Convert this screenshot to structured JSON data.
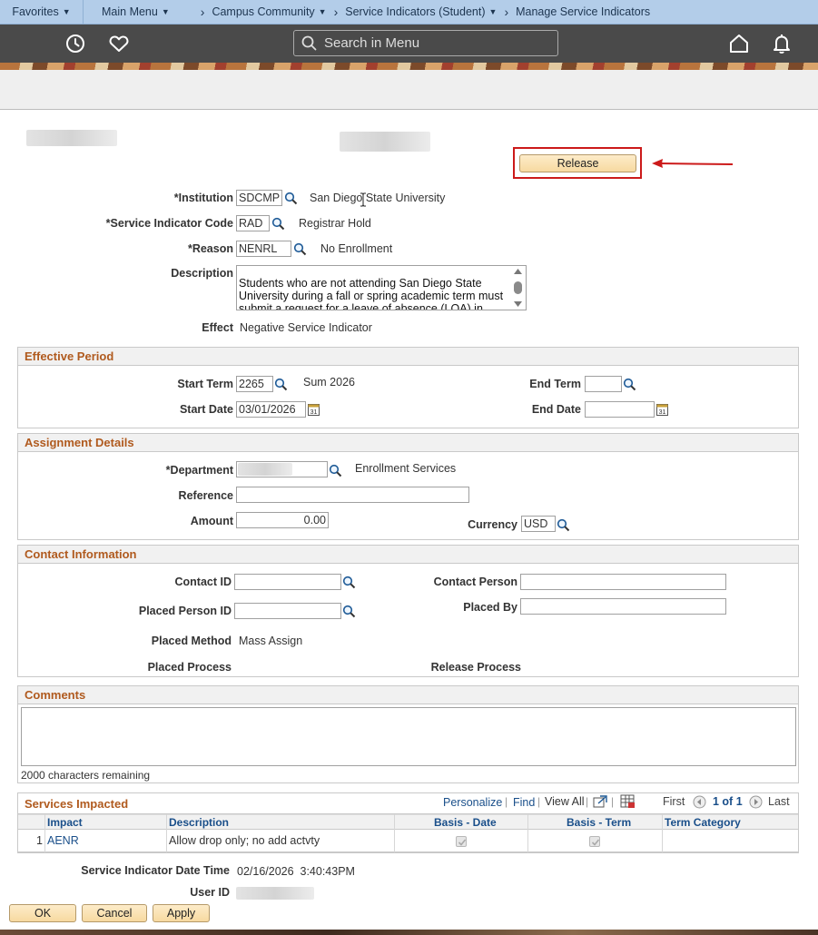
{
  "breadcrumb": {
    "favorites": "Favorites",
    "main_menu": "Main Menu",
    "campus_community": "Campus Community",
    "service_indicators": "Service Indicators (Student)",
    "current": "Manage Service Indicators"
  },
  "header": {
    "search_placeholder": "Search in Menu"
  },
  "actions": {
    "release_label": "Release"
  },
  "fields": {
    "institution": {
      "label": "*Institution",
      "value": "SDCMP",
      "description": "San Diego State University"
    },
    "service_indicator_code": {
      "label": "*Service Indicator Code",
      "value": "RAD",
      "description": "Registrar Hold"
    },
    "reason": {
      "label": "*Reason",
      "value": "NENRL",
      "description": "No Enrollment"
    },
    "description": {
      "label": "Description",
      "text": "Students who are not attending San Diego State University during a fall or spring academic term must submit a request for a leave of absence (LOA) in order"
    },
    "effect": {
      "label": "Effect",
      "value": "Negative Service Indicator"
    }
  },
  "effective_period": {
    "title": "Effective Period",
    "start_term_label": "Start Term",
    "start_term": "2265",
    "start_term_desc": "Sum 2026",
    "end_term_label": "End Term",
    "end_term": "",
    "start_date_label": "Start Date",
    "start_date": "03/01/2026",
    "end_date_label": "End Date",
    "end_date": ""
  },
  "assignment_details": {
    "title": "Assignment Details",
    "department_label": "*Department",
    "department_desc": "Enrollment Services",
    "reference_label": "Reference",
    "reference": "",
    "amount_label": "Amount",
    "amount": "0.00",
    "currency_label": "Currency",
    "currency": "USD"
  },
  "contact_information": {
    "title": "Contact Information",
    "contact_id_label": "Contact ID",
    "contact_person_label": "Contact Person",
    "placed_person_id_label": "Placed Person ID",
    "placed_by_label": "Placed By",
    "placed_method_label": "Placed Method",
    "placed_method": "Mass Assign",
    "placed_process_label": "Placed Process",
    "release_process_label": "Release Process"
  },
  "comments": {
    "title": "Comments",
    "remaining": "2000 characters remaining"
  },
  "services_impacted": {
    "title": "Services Impacted",
    "personalize": "Personalize",
    "find": "Find",
    "view_all": "View All",
    "first": "First",
    "page": "1 of 1",
    "last": "Last",
    "columns": [
      "Impact",
      "Description",
      "Basis - Date",
      "Basis - Term",
      "Term Category"
    ],
    "rows": [
      {
        "num": "1",
        "impact": "AENR",
        "description": "Allow drop only; no add actvty",
        "basis_date": true,
        "basis_term": true,
        "term_category": ""
      }
    ]
  },
  "footer_info": {
    "datetime_label": "Service Indicator Date Time",
    "datetime": "02/16/2026  3:40:43PM",
    "user_id_label": "User ID"
  },
  "buttons": {
    "ok": "OK",
    "cancel": "Cancel",
    "apply": "Apply"
  }
}
